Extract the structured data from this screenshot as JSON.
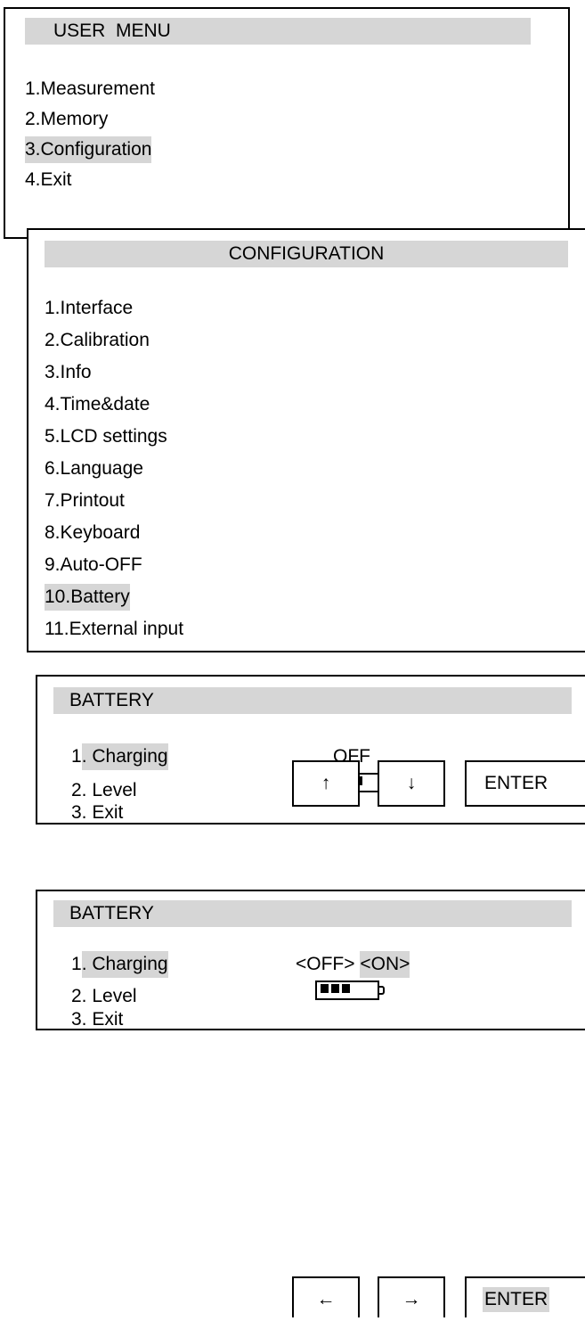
{
  "user_menu": {
    "title": "USER  MENU",
    "items": [
      "1.Measurement",
      "2.Memory",
      "3.Configuration",
      "4.Exit"
    ],
    "selected_index": 2
  },
  "configuration": {
    "title": "CONFIGURATION",
    "items": [
      "1.Interface",
      "2.Calibration",
      "3.Info",
      "4.Time&date",
      "5.LCD settings",
      "6.Language",
      "7.Printout",
      "8.Keyboard",
      "9.Auto-OFF",
      "10.Battery",
      "11.External input"
    ],
    "selected_index": 9
  },
  "battery_screen_1": {
    "title": "BATTERY",
    "item1_num": "1",
    "item1_rest": ". Charging",
    "item2": "2. Level",
    "item3": "3. Exit",
    "charging_value": "OFF",
    "battery_cells": 3
  },
  "buttons_1": {
    "up": "↑",
    "down": "↓",
    "enter": "ENTER"
  },
  "battery_screen_2": {
    "title": "BATTERY",
    "item1_num": "1",
    "item1_rest": ". Charging",
    "item2": "2. Level",
    "item3": "3. Exit",
    "option_off": "<OFF>",
    "option_on": "<ON>",
    "battery_cells": 3
  },
  "buttons_2": {
    "left": "←",
    "right": "→",
    "enter": "ENTER"
  },
  "colors": {
    "highlight": "#d6d6d6",
    "border": "#000000",
    "background": "#ffffff"
  }
}
